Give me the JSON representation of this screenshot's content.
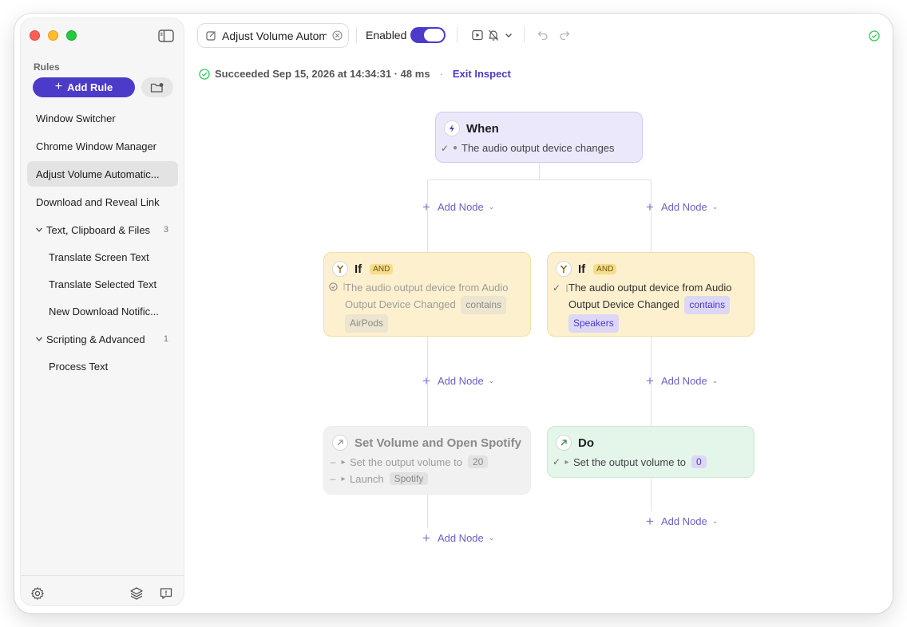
{
  "sidebar": {
    "section_label": "Rules",
    "add_rule_label": "Add Rule",
    "items": [
      {
        "label": "Window Switcher"
      },
      {
        "label": "Chrome Window Manager"
      },
      {
        "label": "Adjust Volume Automatic..."
      },
      {
        "label": "Download and Reveal Link"
      },
      {
        "label": "Text, Clipboard & Files",
        "count": "3"
      },
      {
        "label": "Translate Screen Text"
      },
      {
        "label": "Translate Selected Text"
      },
      {
        "label": "New Download Notific..."
      },
      {
        "label": "Scripting & Advanced",
        "count": "1"
      },
      {
        "label": "Process Text"
      }
    ]
  },
  "toolbar": {
    "rule_title": "Adjust Volume Autom",
    "enabled_label": "Enabled"
  },
  "status": {
    "text": "Succeeded Sep 15, 2026 at 14:34:31 · 48 ms",
    "separator": "·",
    "exit_label": "Exit Inspect"
  },
  "flow": {
    "when": {
      "title": "When",
      "line": "The audio output device changes"
    },
    "if_left": {
      "title": "If",
      "badge": "AND",
      "line1": "The audio output device from Audio",
      "line2": "Output Device Changed",
      "operator": "contains",
      "value": "AirPods"
    },
    "if_right": {
      "title": "If",
      "badge": "AND",
      "line1": "The audio output device from Audio",
      "line2": "Output Device Changed",
      "operator": "contains",
      "value": "Speakers"
    },
    "set_volume": {
      "title": "Set Volume and Open Spotify",
      "action1": "Set the output volume to",
      "action1_value": "20",
      "action2": "Launch",
      "action2_value": "Spotify"
    },
    "do": {
      "title": "Do",
      "action1": "Set the output volume to",
      "action1_value": "0"
    },
    "add_node_label": "Add Node"
  },
  "colors": {
    "accent": "#4b3bc8",
    "when_bg": "#ebe8fb",
    "if_bg": "#fdf0cf",
    "do_bg": "#e4f5ea",
    "success": "#34c759"
  }
}
